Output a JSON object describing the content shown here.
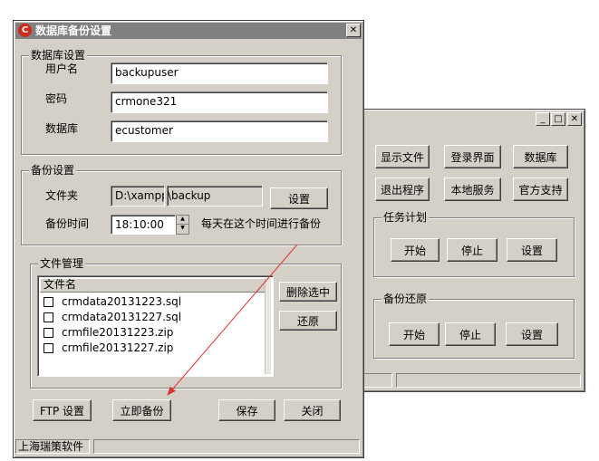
{
  "main_window": {
    "title": "数据库备份设置",
    "close_glyph": "✕",
    "app_icon_letter": "C",
    "db_group": {
      "label": "数据库设置",
      "username_label": "用户名",
      "username_value": "backupuser",
      "password_label": "密码",
      "password_value": "crmone321",
      "database_label": "数据库",
      "database_value": "ecustomer"
    },
    "backup_group": {
      "label": "备份设置",
      "folder_label": "文件夹",
      "folder_part1": "D:\\xampp",
      "folder_part2": "\\backup",
      "settings_button": "设置",
      "time_label": "备份时间",
      "time_value": "18:10:00",
      "time_hint": "每天在这个时间进行备份"
    },
    "file_group": {
      "label": "文件管理",
      "column_header": "文件名",
      "files": [
        "crmdata20131223.sql",
        "crmdata20131227.sql",
        "crmfile20131223.zip",
        "crmfile20131227.zip"
      ],
      "delete_button": "删除选中",
      "restore_button": "还原"
    },
    "buttons": {
      "ftp": "FTP 设置",
      "backup_now": "立即备份",
      "save": "保存",
      "close": "关闭"
    },
    "status_text": "上海瑞策软件"
  },
  "back_window": {
    "min_glyph": "_",
    "max_glyph": "□",
    "close_glyph": "✕",
    "buttons_row1": [
      "显示文件",
      "登录界面",
      "数据库"
    ],
    "buttons_row2": [
      "退出程序",
      "本地服务",
      "官方支持"
    ],
    "task_group": {
      "label": "任务计划",
      "start": "开始",
      "stop": "停止",
      "settings": "设置"
    },
    "restore_group": {
      "label": "备份还原",
      "start": "开始",
      "stop": "停止",
      "settings": "设置"
    }
  },
  "colors": {
    "window_bg": "#d4d0c8",
    "annotation_arrow": "#e03030",
    "app_icon": "#d02a1e"
  }
}
